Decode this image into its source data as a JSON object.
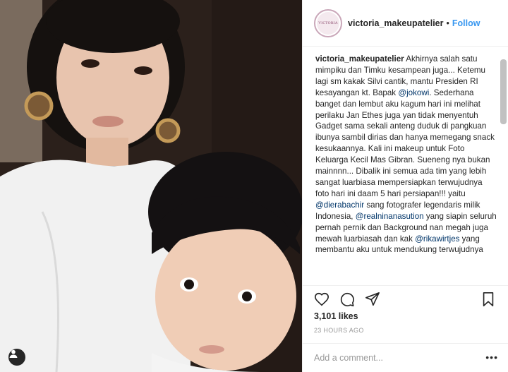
{
  "post": {
    "username": "victoria_makeupatelier",
    "separator": "•",
    "follow_label": "Follow",
    "avatar_text": "VICTORIA",
    "caption_user": "victoria_makeupatelier",
    "caption": {
      "p1": " Akhirnya salah satu mimpiku dan Timku kesampean juga... Ketemu lagi sm kakak Silvi cantik, mantu Presiden RI kesayangan kt. Bapak ",
      "m1": "@jokowi",
      "p2": ". Sederhana banget dan lembut aku kagum hari ini melihat perilaku Jan Ethes juga yan tidak menyentuh Gadget sama sekali anteng duduk di pangkuan ibunya sambil dirias dan hanya memegang snack kesukaannya. Kali ini makeup untuk Foto Keluarga Kecil Mas Gibran. Sueneng nya bukan mainnnn... Dibalik ini semua ada tim yang lebih sangat luarbiasa mempersiapkan terwujudnya foto hari ini daam 5 hari persiapan!!! yaitu ",
      "m2": "@dierabachir",
      "p3": " sang fotografer legendaris milik Indonesia, ",
      "m3": "@realninanasution",
      "p4": " yang siapin seluruh pernah pernik dan Background nan megah juga mewah luarbiasah dan kak ",
      "m4": "@rikawirtjes",
      "p5": " yang membantu aku untuk mendukung terwujudnya"
    },
    "likes": "3,101 likes",
    "timestamp": "23 HOURS AGO",
    "comment_placeholder": "Add a comment...",
    "more": "•••"
  },
  "icons": {
    "like": "heart-icon",
    "comment": "comment-bubble-icon",
    "share": "share-paper-plane-icon",
    "save": "bookmark-icon",
    "tag": "user-tag-icon"
  },
  "colors": {
    "follow": "#3897f0",
    "mention": "#003569",
    "border": "#efefef",
    "muted": "#999999"
  }
}
